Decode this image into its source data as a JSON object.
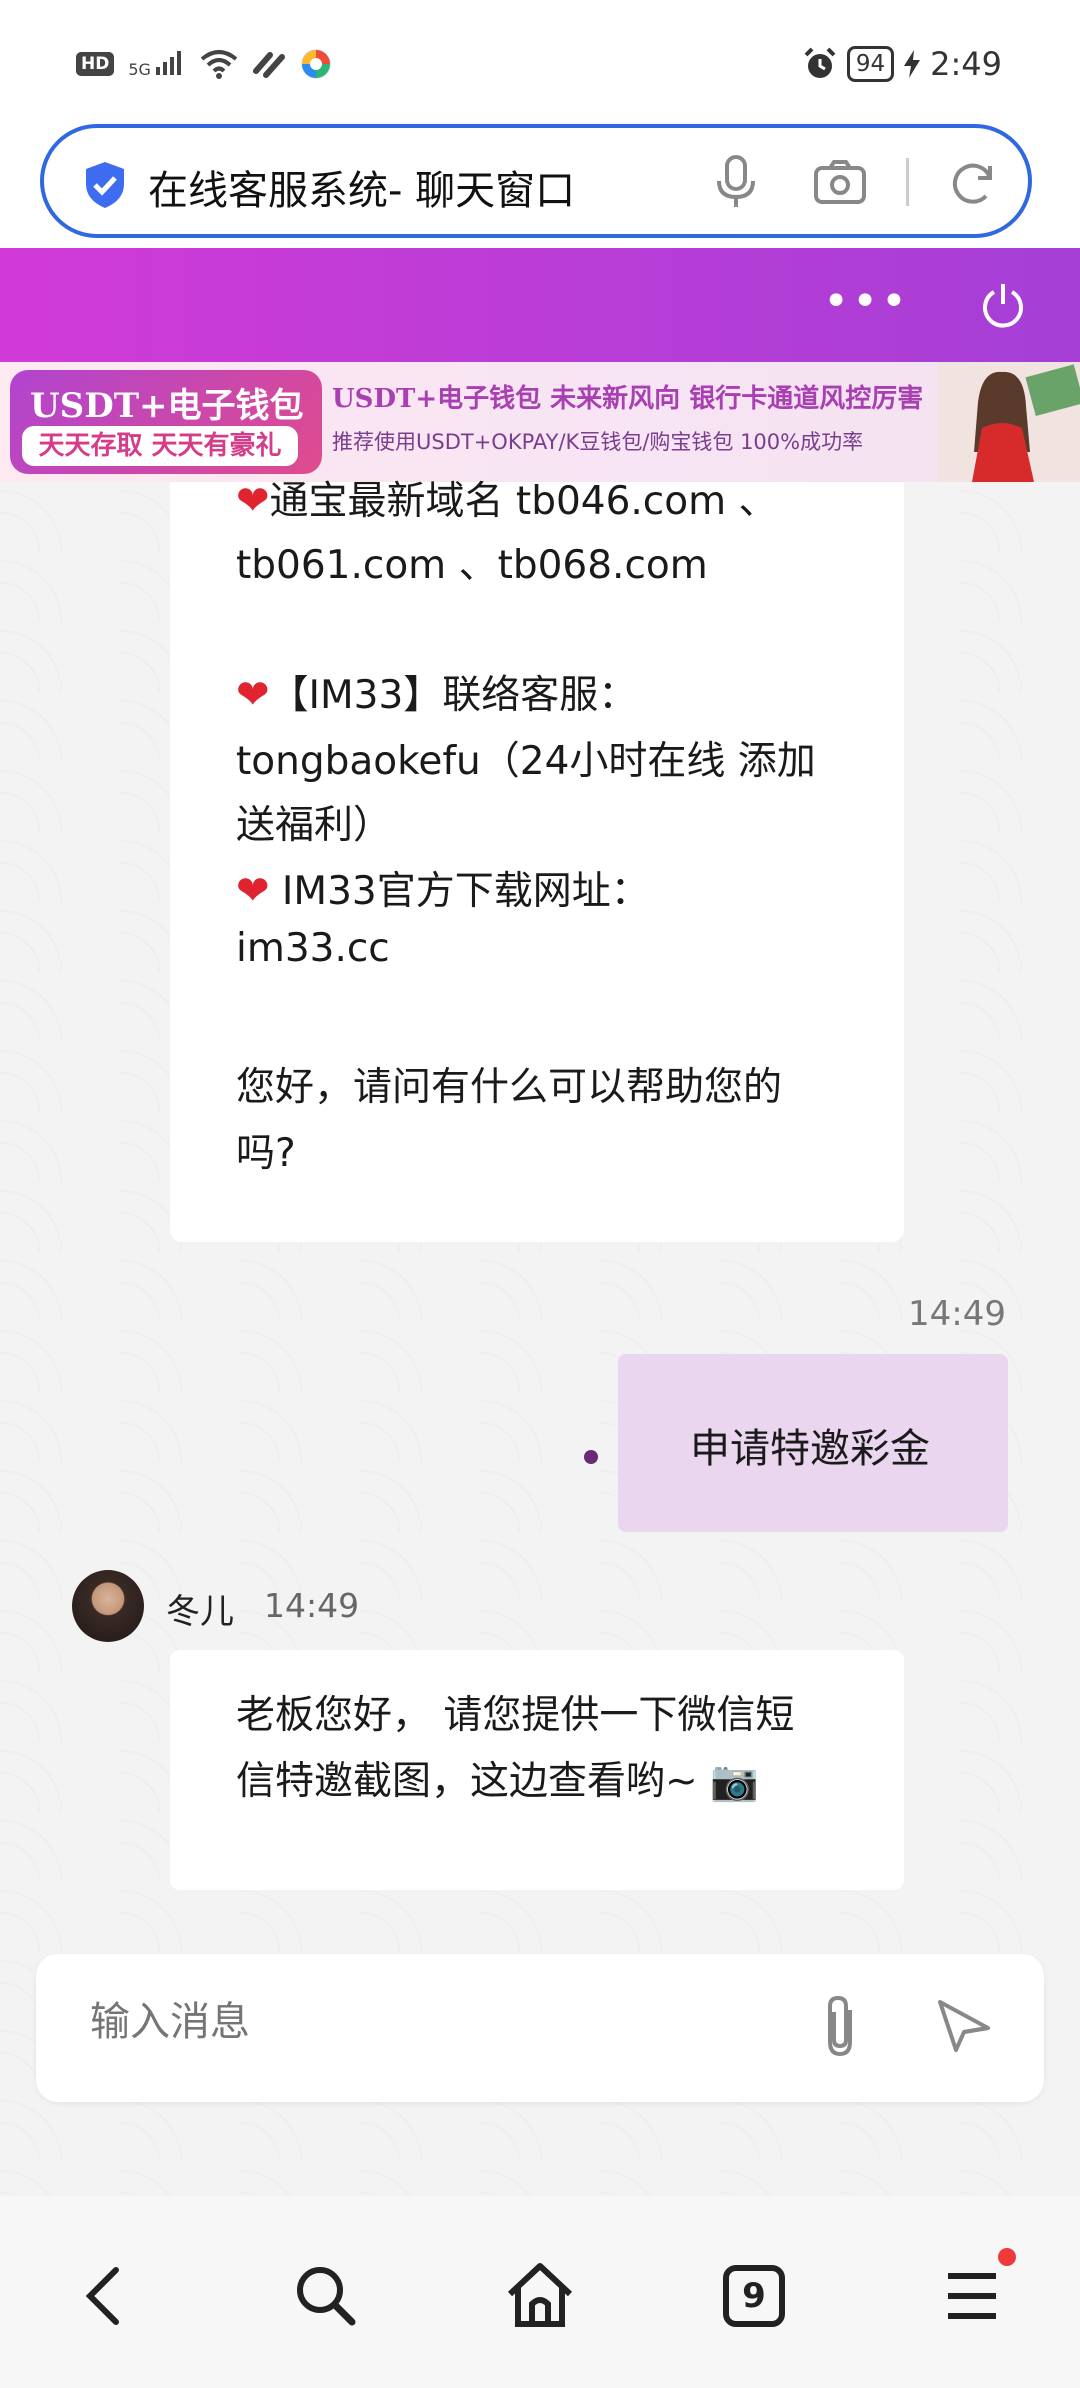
{
  "status_bar": {
    "hd_label": "HD",
    "network_label": "5G",
    "battery": "94",
    "time": "2:49"
  },
  "url_bar": {
    "title": "在线客服系统- 聊天窗口"
  },
  "banner": {
    "left_line1": "USDT+电子钱包",
    "left_line2": "天天存取 天天有豪礼",
    "right_line1": "USDT+电子钱包  未来新风向  银行卡通道风控厉害",
    "right_line2": "推荐使用USDT+OKPAY/K豆钱包/购宝钱包   100%成功率"
  },
  "messages": {
    "first": {
      "lines": [
        "通宝最新域名 tb046.com 、",
        "tb061.com 、tb068.com",
        "【IM33】联络客服：",
        "tongbaokefu（24小时在线 添加",
        "送福利）",
        " IM33官方下载网址：",
        "im33.cc",
        "您好，请问有什么可以帮助您的",
        "吗?"
      ],
      "heart": "❤"
    },
    "user": {
      "time": "14:49",
      "text": "申请特邀彩金"
    },
    "agent": {
      "name": "冬儿",
      "time": "14:49",
      "line1": "老板您好， 请您提供一下微信短",
      "line2": "信特邀截图，这边查看哟~ 📷"
    }
  },
  "input": {
    "placeholder": "输入消息"
  },
  "nav": {
    "tabs_count": "9"
  },
  "colors": {
    "header": "#c23ad8",
    "url_border": "#2f68e0",
    "user_bubble": "#ead6ef"
  }
}
